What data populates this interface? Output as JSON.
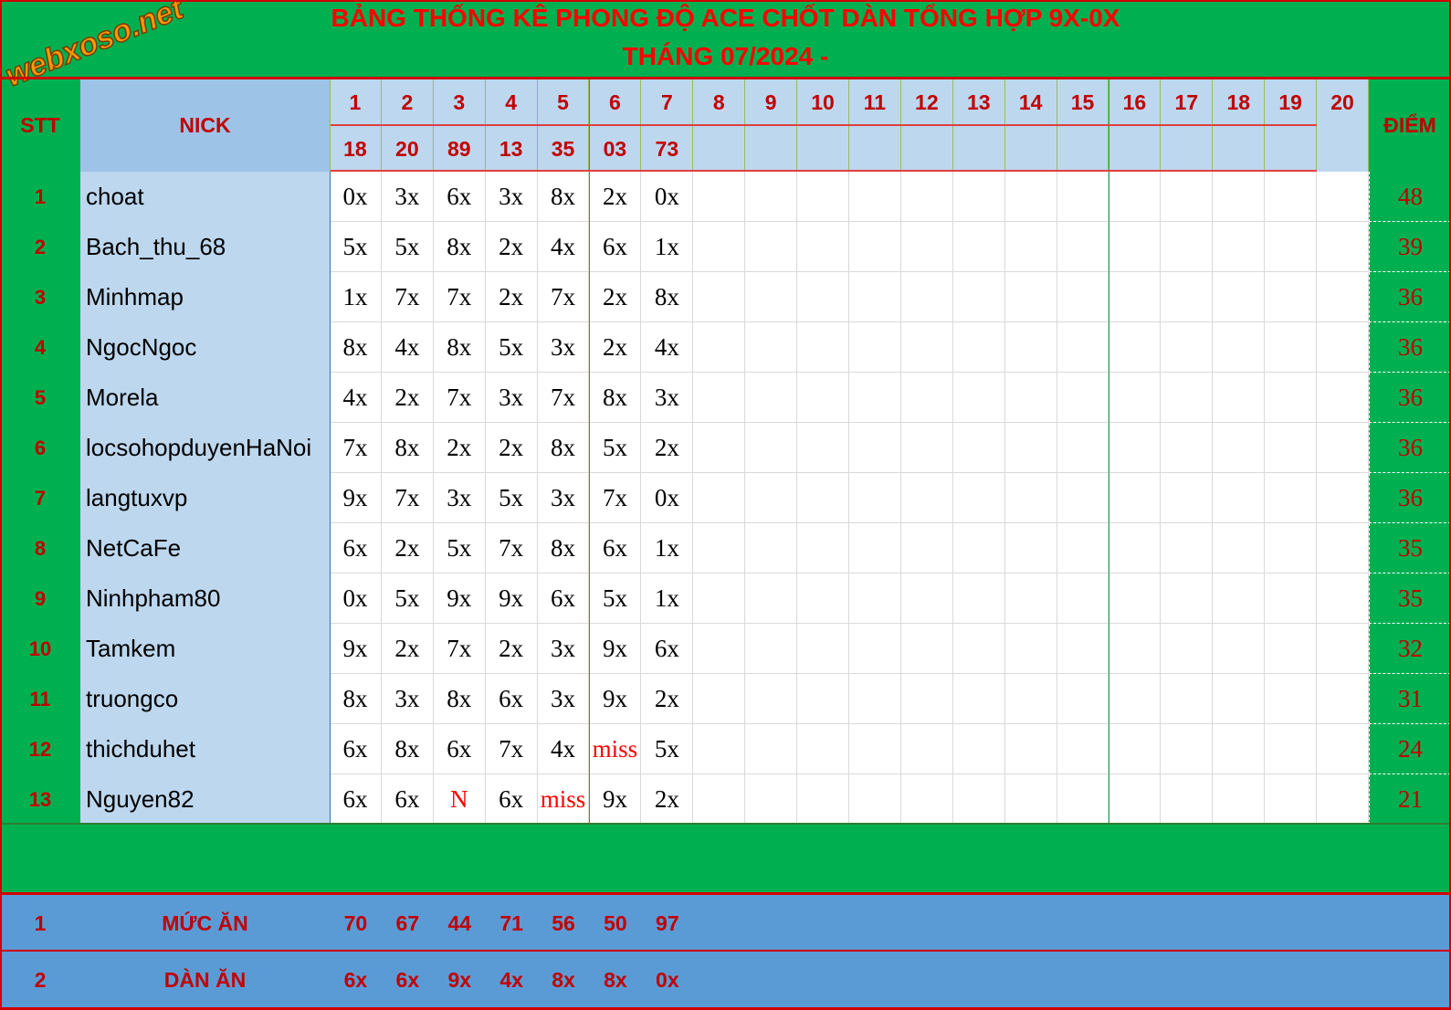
{
  "title": {
    "line1": "BẢNG THỐNG KÊ PHONG ĐỘ ACE CHỐT DÀN TỔNG HỢP 9X-0X",
    "line2": "THÁNG 07/2024 -"
  },
  "logo_text": "webxoso.net",
  "header": {
    "stt": "STT",
    "nick": "NICK",
    "diem": "ĐIỂM",
    "days": [
      "1",
      "2",
      "3",
      "4",
      "5",
      "6",
      "7",
      "8",
      "9",
      "10",
      "11",
      "12",
      "13",
      "14",
      "15",
      "16",
      "17",
      "18",
      "19",
      "20"
    ],
    "results": [
      "18",
      "20",
      "89",
      "13",
      "35",
      "03",
      "73"
    ]
  },
  "rows": [
    {
      "stt": "1",
      "nick": "choat",
      "values": [
        "0x",
        "3x",
        "6x",
        "3x",
        "8x",
        "2x",
        "0x"
      ],
      "score": "48"
    },
    {
      "stt": "2",
      "nick": "Bach_thu_68",
      "values": [
        "5x",
        "5x",
        "8x",
        "2x",
        "4x",
        "6x",
        "1x"
      ],
      "score": "39"
    },
    {
      "stt": "3",
      "nick": "Minhmap",
      "values": [
        "1x",
        "7x",
        "7x",
        "2x",
        "7x",
        "2x",
        "8x"
      ],
      "score": "36"
    },
    {
      "stt": "4",
      "nick": "NgocNgoc",
      "values": [
        "8x",
        "4x",
        "8x",
        "5x",
        "3x",
        "2x",
        "4x"
      ],
      "score": "36"
    },
    {
      "stt": "5",
      "nick": "Morela",
      "values": [
        "4x",
        "2x",
        "7x",
        "3x",
        "7x",
        "8x",
        "3x"
      ],
      "score": "36"
    },
    {
      "stt": "6",
      "nick": "locsohopduyenHaNoi",
      "values": [
        "7x",
        "8x",
        "2x",
        "2x",
        "8x",
        "5x",
        "2x"
      ],
      "score": "36"
    },
    {
      "stt": "7",
      "nick": "langtuxvp",
      "values": [
        "9x",
        "7x",
        "3x",
        "5x",
        "3x",
        "7x",
        "0x"
      ],
      "score": "36"
    },
    {
      "stt": "8",
      "nick": "NetCaFe",
      "values": [
        "6x",
        "2x",
        "5x",
        "7x",
        "8x",
        "6x",
        "1x"
      ],
      "score": "35"
    },
    {
      "stt": "9",
      "nick": "Ninhpham80",
      "values": [
        "0x",
        "5x",
        "9x",
        "9x",
        "6x",
        "5x",
        "1x"
      ],
      "score": "35"
    },
    {
      "stt": "10",
      "nick": "Tamkem",
      "values": [
        "9x",
        "2x",
        "7x",
        "2x",
        "3x",
        "9x",
        "6x"
      ],
      "score": "32"
    },
    {
      "stt": "11",
      "nick": "truongco",
      "values": [
        "8x",
        "3x",
        "8x",
        "6x",
        "3x",
        "9x",
        "2x"
      ],
      "score": "31"
    },
    {
      "stt": "12",
      "nick": "thichduhet",
      "values": [
        "6x",
        "8x",
        "6x",
        "7x",
        "4x",
        "miss",
        "5x"
      ],
      "score": "24"
    },
    {
      "stt": "13",
      "nick": "Nguyen82",
      "values": [
        "6x",
        "6x",
        "N",
        "6x",
        "miss",
        "9x",
        "2x"
      ],
      "score": "21"
    }
  ],
  "footer": [
    {
      "stt": "1",
      "label": "MỨC ĂN",
      "values": [
        "70",
        "67",
        "44",
        "71",
        "56",
        "50",
        "97"
      ]
    },
    {
      "stt": "2",
      "label": "DÀN ĂN",
      "values": [
        "6x",
        "6x",
        "9x",
        "4x",
        "8x",
        "8x",
        "0x"
      ]
    }
  ],
  "colors": {
    "green": "#00b050",
    "light_blue": "#bdd7ee",
    "blue": "#5b9bd5",
    "red": "#ff0000",
    "dark_red": "#c00000"
  }
}
